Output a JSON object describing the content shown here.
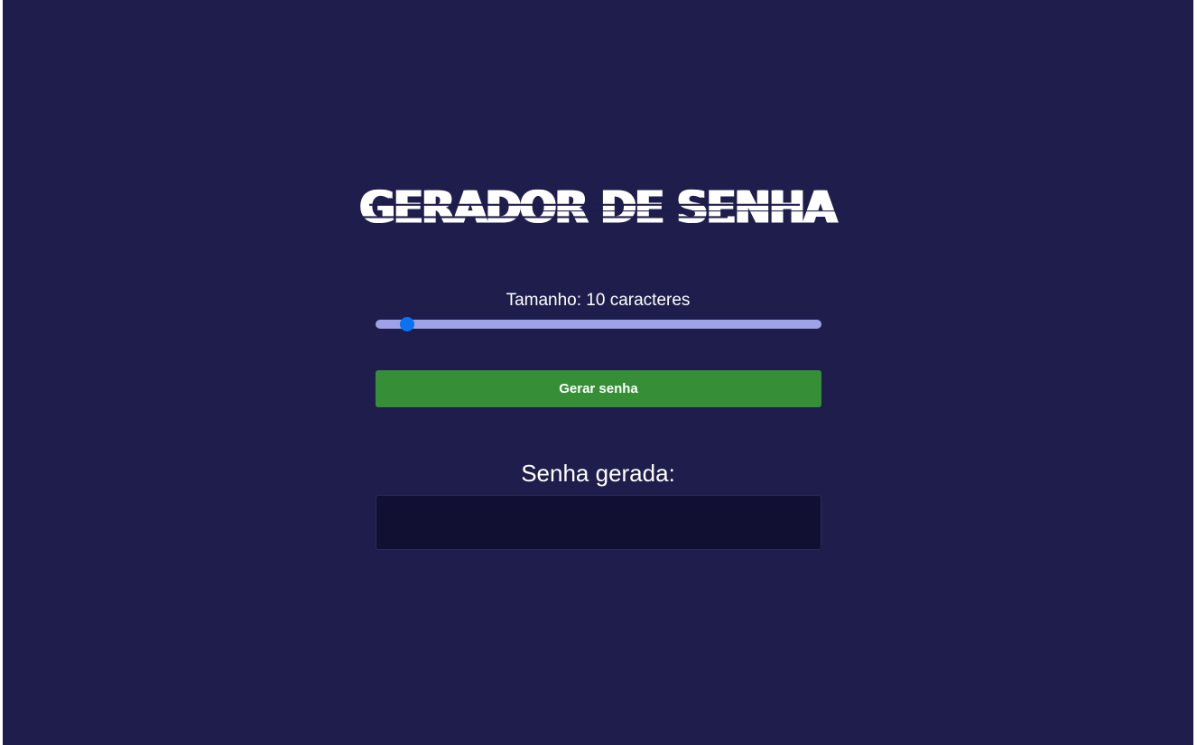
{
  "app": {
    "title": "GERADOR DE SENHA"
  },
  "length_control": {
    "label": "Tamanho: 10 caracteres",
    "value": 10,
    "min": 6,
    "max": 64
  },
  "generate_button": {
    "label": "Gerar senha"
  },
  "result": {
    "label": "Senha gerada:",
    "value": ""
  },
  "colors": {
    "background": "#1e1d4b",
    "slider_track": "#9fa2e6",
    "slider_thumb": "#0b72f0",
    "button": "#368f37",
    "result_box": "#121032"
  }
}
